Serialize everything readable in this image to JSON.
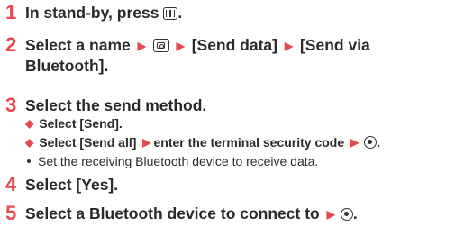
{
  "steps": [
    {
      "number": "1",
      "text": "In stand-by, press",
      "tail": "."
    },
    {
      "number": "2",
      "parts": [
        "Select a name",
        "[Send data]",
        "[Send via"
      ],
      "line2": "Bluetooth]."
    },
    {
      "number": "3",
      "text": "Select the send method."
    },
    {
      "number": "4",
      "text": "Select [Yes]."
    },
    {
      "number": "5",
      "text": "Select a Bluetooth device to connect to",
      "tail": "."
    }
  ],
  "sub_items": {
    "send": "Select [Send].",
    "send_all_a": "Select [Send all]",
    "send_all_b": "enter the terminal security code",
    "note": "Set the receiving Bluetooth device to receive data."
  },
  "icons": {
    "phonebook_key": "phonebook-key-icon",
    "camera_key": "camera-key-icon",
    "center_key": "center-key-icon",
    "arrow": "right-arrow-icon"
  },
  "colors": {
    "accent": "#e5484d",
    "text": "#2a2a2a"
  }
}
